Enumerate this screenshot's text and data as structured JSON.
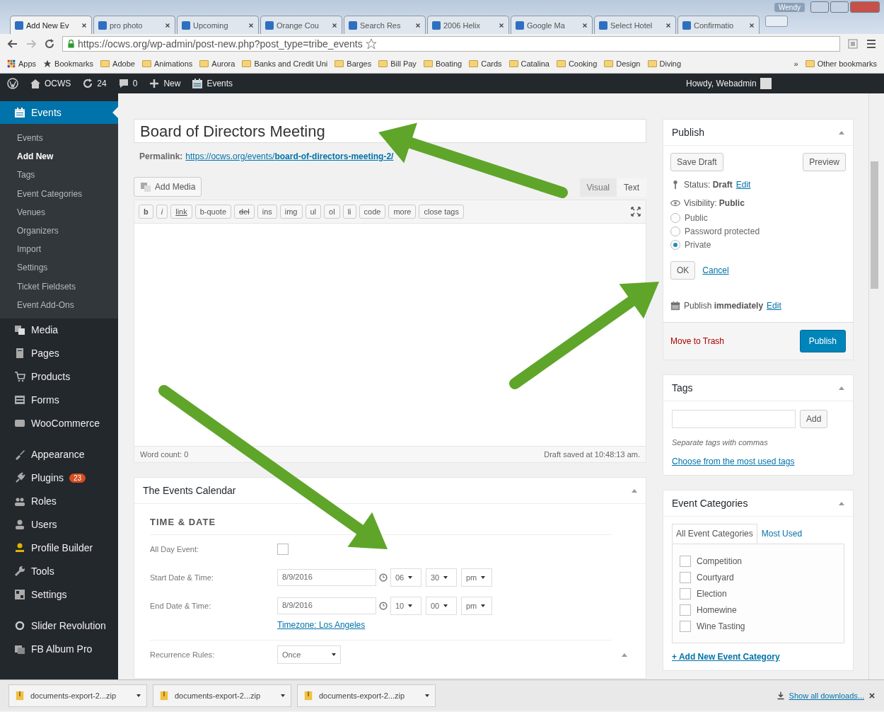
{
  "browser": {
    "tabs": [
      {
        "title": "Add New Ev",
        "selected": true
      },
      {
        "title": "pro photo",
        "selected": false
      },
      {
        "title": "Upcoming",
        "selected": false
      },
      {
        "title": "Orange Cou",
        "selected": false
      },
      {
        "title": "Search Res",
        "selected": false
      },
      {
        "title": "2006 Helix",
        "selected": false
      },
      {
        "title": "Google Ma",
        "selected": false
      },
      {
        "title": "Select Hotel",
        "selected": false
      },
      {
        "title": "Confirmatio",
        "selected": false
      }
    ],
    "profile": "Wendy",
    "url": {
      "secure": true,
      "text": "https://ocws.org/wp-admin/post-new.php?post_type=tribe_events"
    },
    "bookmarks": [
      {
        "label": "Apps",
        "kind": "apps"
      },
      {
        "label": "Bookmarks",
        "kind": "star"
      },
      {
        "label": "Adobe",
        "kind": "folder"
      },
      {
        "label": "Animations",
        "kind": "folder"
      },
      {
        "label": "Aurora",
        "kind": "folder"
      },
      {
        "label": "Banks and Credit Uni",
        "kind": "folder"
      },
      {
        "label": "Barges",
        "kind": "folder"
      },
      {
        "label": "Bill Pay",
        "kind": "folder"
      },
      {
        "label": "Boating",
        "kind": "folder"
      },
      {
        "label": "Cards",
        "kind": "folder"
      },
      {
        "label": "Catalina",
        "kind": "folder"
      },
      {
        "label": "Cooking",
        "kind": "folder"
      },
      {
        "label": "Design",
        "kind": "folder"
      },
      {
        "label": "Diving",
        "kind": "folder"
      },
      {
        "label": "»",
        "kind": "more"
      },
      {
        "label": "Other bookmarks",
        "kind": "folder"
      }
    ]
  },
  "admin_bar": {
    "site": "OCWS",
    "updates": "24",
    "comments": "0",
    "new": "New",
    "events": "Events",
    "greeting": "Howdy, Webadmin"
  },
  "sidebar": {
    "groups": [
      {
        "items": [
          {
            "label": "Events",
            "current": true,
            "children": [
              {
                "label": "Events",
                "current": false
              },
              {
                "label": "Add New",
                "current": true
              },
              {
                "label": "Tags",
                "current": false
              },
              {
                "label": "Event Categories",
                "current": false
              },
              {
                "label": "Venues",
                "current": false
              },
              {
                "label": "Organizers",
                "current": false
              },
              {
                "label": "Import",
                "current": false
              },
              {
                "label": "Settings",
                "current": false
              },
              {
                "label": "Ticket Fieldsets",
                "current": false
              },
              {
                "label": "Event Add-Ons",
                "current": false
              }
            ]
          },
          {
            "label": "Media",
            "current": false
          },
          {
            "label": "Pages",
            "current": false
          },
          {
            "label": "Products",
            "current": false
          },
          {
            "label": "Forms",
            "current": false
          },
          {
            "label": "WooCommerce",
            "current": false
          }
        ]
      },
      {
        "items": [
          {
            "label": "Appearance",
            "current": false
          },
          {
            "label": "Plugins",
            "current": false,
            "badge": "23"
          },
          {
            "label": "Roles",
            "current": false
          },
          {
            "label": "Users",
            "current": false
          },
          {
            "label": "Profile Builder",
            "current": false
          },
          {
            "label": "Tools",
            "current": false
          },
          {
            "label": "Settings",
            "current": false
          }
        ]
      },
      {
        "items": [
          {
            "label": "Slider Revolution",
            "current": false
          },
          {
            "label": "FB Album Pro",
            "current": false
          }
        ]
      }
    ]
  },
  "editor": {
    "title": "Board of Directors Meeting",
    "permalink_label": "Permalink:",
    "permalink": "https://ocws.org/events/**board-of-directors-meeting-2/**",
    "add_media": "Add Media",
    "modes": [
      {
        "label": "Visual",
        "selected": false
      },
      {
        "label": "Text",
        "selected": true
      }
    ],
    "quicktags": [
      {
        "label": "b",
        "kind": "bold"
      },
      {
        "label": "i",
        "kind": "italic"
      },
      {
        "label": "link",
        "kind": "link"
      },
      {
        "label": "b-quote",
        "kind": "tag"
      },
      {
        "label": "del",
        "kind": "deletion"
      },
      {
        "label": "ins",
        "kind": "tag"
      },
      {
        "label": "img",
        "kind": "tag"
      },
      {
        "label": "ul",
        "kind": "tag"
      },
      {
        "label": "ol",
        "kind": "tag"
      },
      {
        "label": "li",
        "kind": "tag"
      },
      {
        "label": "code",
        "kind": "tag"
      },
      {
        "label": "more",
        "kind": "tag"
      },
      {
        "label": "close tags",
        "kind": "tag"
      }
    ],
    "word_count": "Word count: 0",
    "draft_saved": "Draft saved at 10:48:13 am."
  },
  "events_calendar": {
    "title": "The Events Calendar",
    "section": "TIME & DATE",
    "all_day": {
      "label": "All Day Event:",
      "checked": false
    },
    "rows": [
      {
        "label": "Start Date & Time:",
        "date": "8/9/2016",
        "hour": "06",
        "minute": "30",
        "meridian": "pm"
      },
      {
        "label": "End Date & Time:",
        "date": "8/9/2016",
        "hour": "10",
        "minute": "00",
        "meridian": "pm"
      }
    ],
    "timezone": "Timezone: Los Angeles",
    "recurrence": {
      "label": "Recurrence Rules:",
      "value": "Once"
    }
  },
  "publish": {
    "title": "Publish",
    "save_draft": "Save Draft",
    "preview": "Preview",
    "status": "Status: **Draft**",
    "status_edit": "Edit",
    "visibility": "Visibility: **Public**",
    "visibility_options": [
      {
        "label": "Public",
        "selected": false
      },
      {
        "label": "Password protected",
        "selected": false
      },
      {
        "label": "Private",
        "selected": true
      }
    ],
    "ok": "OK",
    "cancel": "Cancel",
    "schedule": "Publish **immediately**",
    "schedule_edit": "Edit",
    "trash": "Move to Trash",
    "publish": "Publish"
  },
  "tags_box": {
    "title": "Tags",
    "add": "Add",
    "hint": "Separate tags with commas",
    "choose": "Choose from the most used tags"
  },
  "categories_box": {
    "title": "Event Categories",
    "tabs": [
      {
        "label": "All Event Categories",
        "selected": true
      },
      {
        "label": "Most Used",
        "selected": false
      }
    ],
    "items": [
      {
        "label": "Competition",
        "checked": false
      },
      {
        "label": "Courtyard",
        "checked": false
      },
      {
        "label": "Election",
        "checked": false
      },
      {
        "label": "Homewine",
        "checked": false
      },
      {
        "label": "Wine Tasting",
        "checked": false
      }
    ],
    "add_new": "+ Add New Event Category"
  },
  "downloads": {
    "items": [
      "documents-export-2...zip",
      "documents-export-2...zip",
      "documents-export-2...zip"
    ],
    "show_all": "Show all downloads..."
  }
}
